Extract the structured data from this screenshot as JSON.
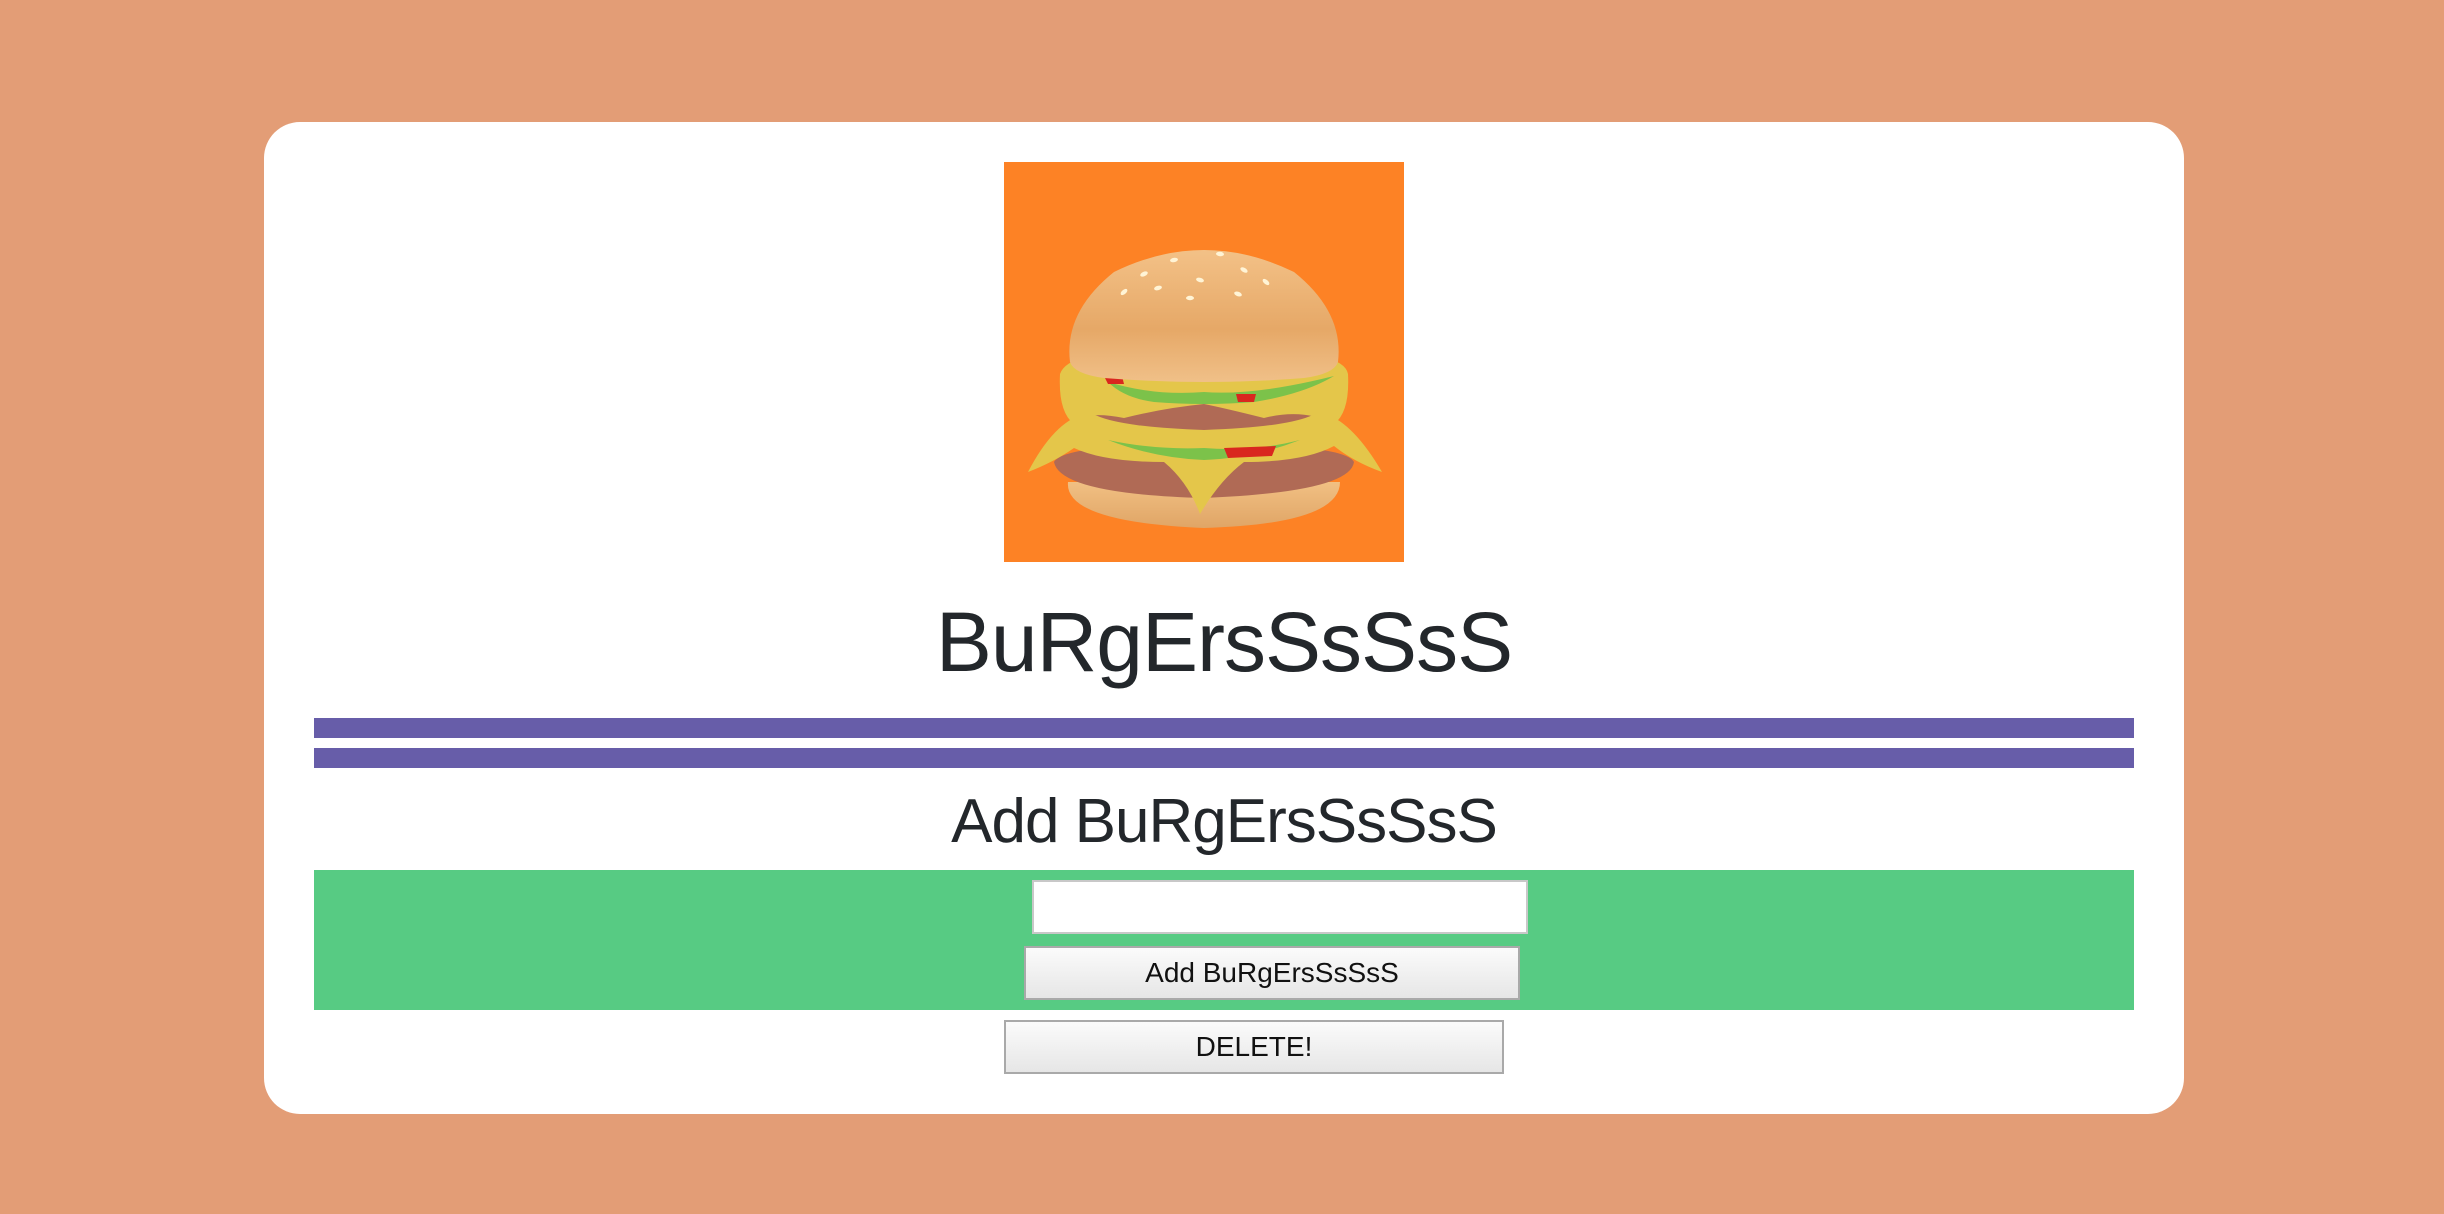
{
  "app": {
    "title": "BuRgErsSsSsS"
  },
  "form": {
    "heading": "Add BuRgErsSsSsS",
    "input_value": "",
    "input_placeholder": "",
    "add_label": "Add BuRgErsSsSsS",
    "delete_label": "DELETE!"
  },
  "colors": {
    "page_background": "#e39d76",
    "card": "#ffffff",
    "logo_background": "#fd8225",
    "divider": "#675da9",
    "form_background": "#57cb83",
    "text": "#23272b"
  },
  "icons": {
    "logo": "burger-logo-icon"
  }
}
